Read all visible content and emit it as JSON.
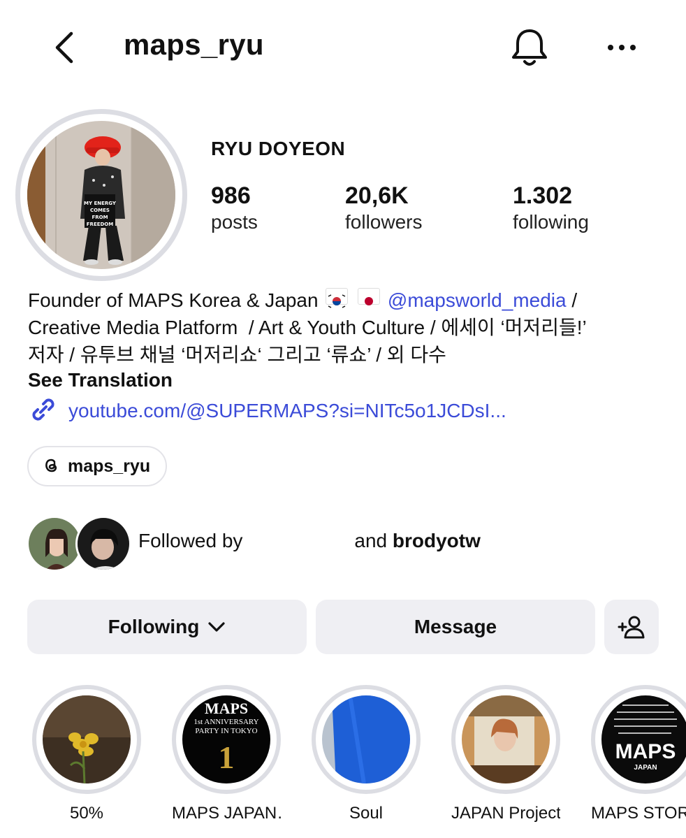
{
  "header": {
    "username": "maps_ryu"
  },
  "profile": {
    "full_name": "RYU DOYEON",
    "stats": [
      {
        "value": "986",
        "label": "posts"
      },
      {
        "value": "20,6K",
        "label": "followers"
      },
      {
        "value": "1.302",
        "label": "following"
      }
    ],
    "avatar_bag_text": "MY ENERGY COMES FROM FREEDOM"
  },
  "bio": {
    "line1_prefix": "Founder of MAPS Korea & Japan",
    "mention": "@mapsworld_media",
    "line1_suffix": " /",
    "line2": "Creative Media Platform  / Art & Youth Culture / 에세이 ‘머저리들!’",
    "line3": "저자 / 유투브 채널 ‘머저리쇼‘ 그리고 ‘류쇼’ / 외 다수",
    "see_translation": "See Translation",
    "link": "youtube.com/@SUPERMAPS?si=NITc5o1JCDsI..."
  },
  "threads": {
    "handle": "maps_ryu"
  },
  "followed_by": {
    "prefix": "Followed by",
    "and": "and",
    "name": "brodyotw"
  },
  "actions": {
    "following": "Following",
    "message": "Message"
  },
  "highlights": [
    {
      "label": "50%"
    },
    {
      "label": "MAPS JAPAN…",
      "cover_title": "MAPS",
      "cover_sub": "1st ANNIVERSARY PARTY IN TOKYO",
      "cover_num": "1"
    },
    {
      "label": "Soul"
    },
    {
      "label": "JAPAN Project"
    },
    {
      "label": "MAPS STOR",
      "cover_title": "MAPS",
      "cover_sub": "JAPAN"
    }
  ],
  "colors": {
    "link": "#3b4bd8",
    "button_bg": "#efeff3",
    "ring": "#dcdde3"
  }
}
